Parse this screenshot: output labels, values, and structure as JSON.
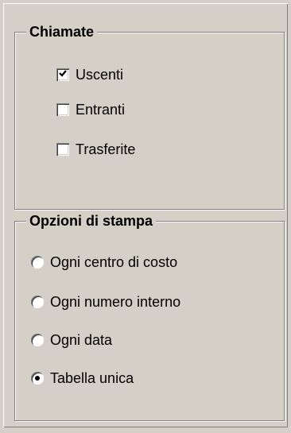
{
  "calls_group": {
    "title": "Chiamate",
    "items": [
      {
        "label": "Uscenti",
        "checked": true
      },
      {
        "label": "Entranti",
        "checked": false
      },
      {
        "label": "Trasferite",
        "checked": false
      }
    ]
  },
  "print_group": {
    "title": "Opzioni di stampa",
    "options": [
      {
        "label": "Ogni centro di costo",
        "selected": false
      },
      {
        "label": "Ogni numero interno",
        "selected": false
      },
      {
        "label": "Ogni data",
        "selected": false
      },
      {
        "label": "Tabella unica",
        "selected": true
      }
    ]
  }
}
